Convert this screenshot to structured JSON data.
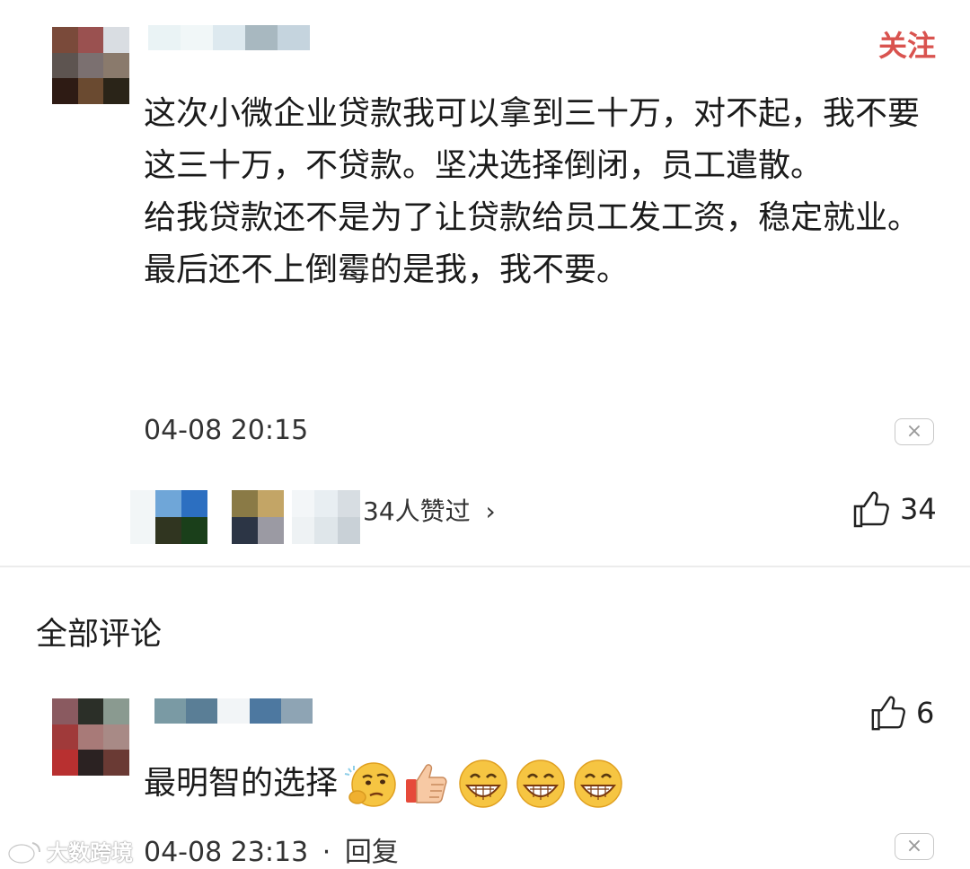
{
  "post": {
    "follow_label": "关注",
    "paragraphs": [
      "这次小微企业贷款我可以拿到三十万，对不起，我不要这三十万，不贷款。坚决选择倒闭，员工遣散。",
      "给我贷款还不是为了让贷款给员工发工资，稳定就业。",
      "最后还不上倒霉的是我，我不要。"
    ],
    "timestamp": "04-08 20:15",
    "close_icon": "×",
    "likers_text": "34人赞过",
    "likers_chevron": "›",
    "like_count": "34"
  },
  "comments_section": {
    "title": "全部评论"
  },
  "comment": {
    "text": "最明智的选择",
    "emojis": [
      "thinking-face",
      "thumbs-up",
      "grin",
      "grin",
      "grin"
    ],
    "like_count": "6",
    "timestamp": "04-08 23:13",
    "separator": "·",
    "reply_label": "回复",
    "close_icon": "×"
  },
  "watermark": {
    "text": "大数跨境"
  }
}
